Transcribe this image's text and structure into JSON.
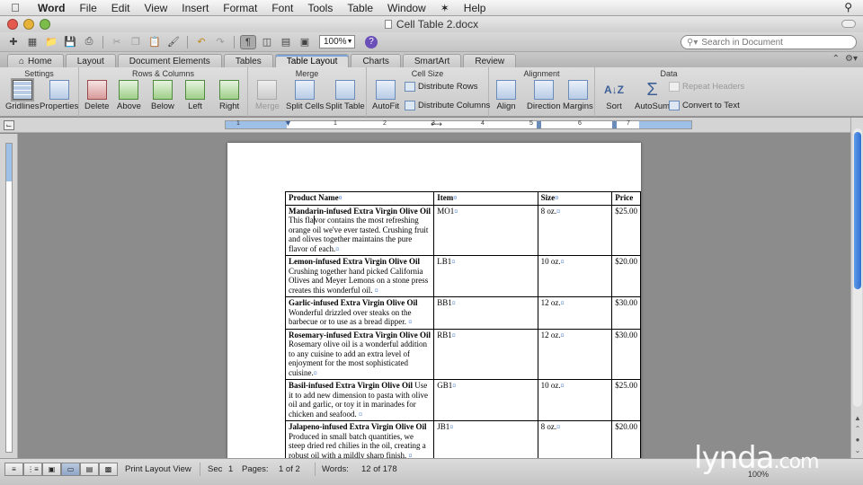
{
  "menubar": {
    "app": "Word",
    "items": [
      "File",
      "Edit",
      "View",
      "Insert",
      "Format",
      "Font",
      "Tools",
      "Table",
      "Window",
      "Help"
    ]
  },
  "window": {
    "title": "Cell Table 2.docx"
  },
  "toolbar": {
    "zoom": "100%",
    "search_placeholder": "Search in Document"
  },
  "ribbon": {
    "tabs": [
      "Home",
      "Layout",
      "Document Elements",
      "Tables",
      "Table Layout",
      "Charts",
      "SmartArt",
      "Review"
    ],
    "active_tab": "Table Layout",
    "groups": {
      "settings": {
        "title": "Settings",
        "gridlines": "Gridlines",
        "properties": "Properties"
      },
      "rows_columns": {
        "title": "Rows & Columns",
        "delete": "Delete",
        "above": "Above",
        "below": "Below",
        "left": "Left",
        "right": "Right"
      },
      "merge": {
        "title": "Merge",
        "merge": "Merge",
        "split_cells": "Split Cells",
        "split_table": "Split Table"
      },
      "cell_size": {
        "title": "Cell Size",
        "autofit": "AutoFit",
        "distribute_rows": "Distribute Rows",
        "distribute_columns": "Distribute Columns"
      },
      "alignment": {
        "title": "Alignment",
        "align": "Align",
        "direction": "Direction",
        "margins": "Margins"
      },
      "data": {
        "title": "Data",
        "sort": "Sort",
        "autosum": "AutoSum",
        "repeat_headers": "Repeat Headers",
        "convert_to_text": "Convert to Text"
      }
    }
  },
  "ruler": {
    "labels": [
      "1",
      "1",
      "2",
      "3",
      "4",
      "5",
      "6",
      "7"
    ]
  },
  "table": {
    "headers": [
      "Product Name",
      "Item",
      "Size",
      "Price"
    ],
    "rows": [
      {
        "name": "Mandarin-infused Extra Virgin Olive Oil",
        "desc_a": " This fla",
        "desc_b": "vor contains the most refreshing orange oil we've ever tasted. Crushing fruit and olives together maintains the pure flavor of each.",
        "item": "MO1",
        "size": "8 oz.",
        "price": "$25.00"
      },
      {
        "name": "Lemon-infused Extra Virgin Olive Oil",
        "desc": " Crushing together hand picked California Olives and Meyer Lemons on a stone press creates this wonderful oil. ",
        "item": "LB1",
        "size": "10 oz.",
        "price": "$20.00"
      },
      {
        "name": "Garlic-infused Extra Virgin Olive Oil",
        "desc": " Wonderful drizzled over steaks on the barbecue or to use as a bread dipper. ",
        "item": "BB1",
        "size": "12 oz.",
        "price": "$30.00"
      },
      {
        "name": "Rosemary-infused Extra Virgin Olive Oil",
        "desc": " Rosemary olive oil is a wonderful addition to any cuisine to add an extra level of enjoyment for the most sophisticated cuisine.",
        "item": "RB1",
        "size": "12 oz.",
        "price": "$30.00"
      },
      {
        "name": "Basil-infused Extra Virgin Olive Oil",
        "desc": " Use it to add new dimension to pasta with olive oil and garlic, or toy it in marinades for chicken and seafood. ",
        "item": "GB1",
        "size": "10 oz.",
        "price": "$25.00"
      },
      {
        "name": "Jalapeno-infused Extra Virgin Olive Oil",
        "desc": " Produced in small batch quantities, we steep dried red chilies in the oil, creating a robust oil with a mildly sharp finish. ",
        "item": "JB1",
        "size": "8 oz.",
        "price": "$20.00"
      }
    ]
  },
  "statusbar": {
    "view": "Print Layout View",
    "sec_label": "Sec",
    "sec_value": "1",
    "pages_label": "Pages:",
    "pages_value": "1 of 2",
    "words_label": "Words:",
    "words_value": "12 of 178",
    "zoom": "100%"
  },
  "watermark": {
    "brand": "lynda",
    "suffix": ".com"
  },
  "colors": {
    "accent": "#2f6fd0",
    "ribbon_active": "#7aa4d8",
    "formatting_mark": "#4a7fd0"
  }
}
